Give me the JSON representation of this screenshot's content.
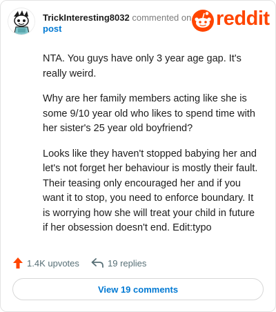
{
  "colors": {
    "brand": "#ff4500",
    "link": "#0079d3",
    "text": "#1c1c1c",
    "muted": "#7c7c7c",
    "action_text": "#576f76"
  },
  "header": {
    "username": "TrickInteresting8032",
    "commented_on": "commented on",
    "post_link": "post",
    "avatar_icon": "snoo-avatar-icon",
    "logo_icon": "reddit-snoo-icon",
    "logo_word": "reddit"
  },
  "comment": {
    "paragraphs": [
      "NTA. You guys have only 3 year age gap. It's really weird.",
      "Why are her family members acting like she is some 9/10 year old who likes to spend time with her sister's 25 year old boyfriend?",
      "Looks like they haven't stopped babying her and let's not forget her behaviour is mostly their fault. Their teasing only encouraged her and if you want it to stop, you need to enforce boundary. It is worrying how she will treat your child in future if her obsession doesn't end. Edit:typo"
    ]
  },
  "actions": {
    "upvotes": "1.4K upvotes",
    "upvote_icon": "upvote-arrow-icon",
    "replies": "19 replies",
    "reply_icon": "reply-arrow-icon"
  },
  "footer": {
    "view_comments": "View 19 comments"
  }
}
